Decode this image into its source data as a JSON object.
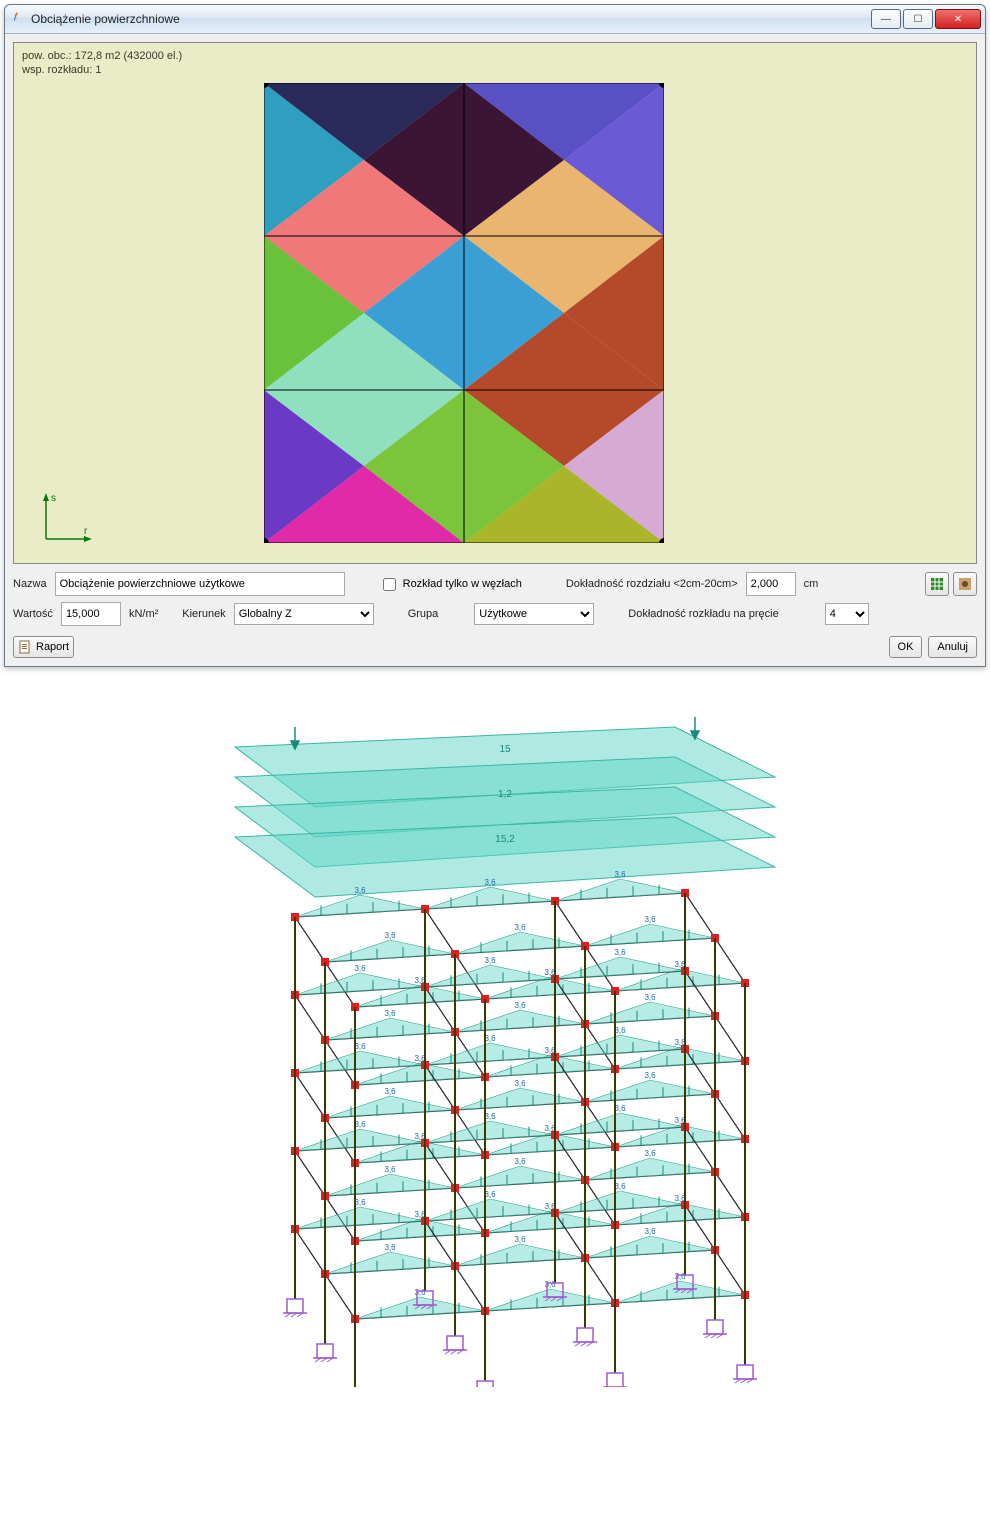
{
  "window": {
    "title": "Obciążenie powierzchniowe"
  },
  "overlay": {
    "line1": "pow. obc.: 172,8 m2 (432000 el.)",
    "line2": "wsp. rozkładu: 1"
  },
  "axis": {
    "s": "s",
    "r": "r"
  },
  "form": {
    "nazwa_label": "Nazwa",
    "nazwa_value": "Obciążenie powierzchniowe użytkowe",
    "wartosc_label": "Wartość",
    "wartosc_value": "15,000",
    "wartosc_unit": "kN/m²",
    "kierunek_label": "Kierunek",
    "kierunek_value": "Globalny Z",
    "rozklad_chk": "Rozkład tylko w węzłach",
    "grupa_label": "Grupa",
    "grupa_value": "Użytkowe",
    "dokladnosc1_label": "Dokładność rozdziału <2cm-20cm>",
    "dokladnosc1_value": "2,000",
    "dokladnosc1_unit": "cm",
    "dokladnosc2_label": "Dokładność rozkładu na pręcie",
    "dokladnosc2_value": "4",
    "raport": "Raport",
    "ok": "OK",
    "anuluj": "Anuluj"
  },
  "model": {
    "top_values": [
      "15",
      "1,2",
      "15,2"
    ],
    "beam_value": "3,6"
  }
}
